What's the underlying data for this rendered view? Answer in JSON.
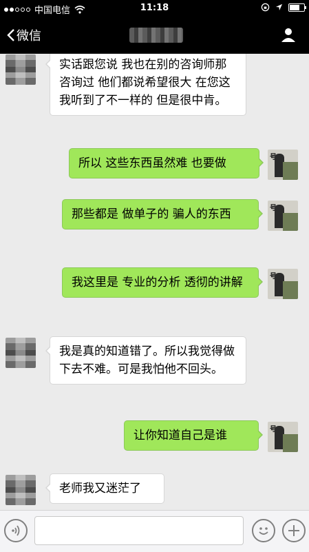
{
  "status_bar": {
    "carrier": "中国电信",
    "time": "11:18"
  },
  "nav": {
    "back_label": "微信"
  },
  "messages": [
    {
      "from": "peer",
      "text": "实话跟您说 我也在别的咨询师那咨询过 他们都说希望很大  在您这 我听到了不一样的 但是很中肯。"
    },
    {
      "from": "me",
      "text": "所以 这些东西虽然难 也要做"
    },
    {
      "from": "me",
      "text": "那些都是 做单子的   骗人的东西"
    },
    {
      "from": "me",
      "text": "我这里是 专业的分析 透彻的讲解"
    },
    {
      "from": "peer",
      "text": "我是真的知道错了。所以我觉得做下去不难。可是我怕他不回头。"
    },
    {
      "from": "me",
      "text": "让你知道自己是谁"
    },
    {
      "from": "peer",
      "text": "老师我又迷茫了"
    }
  ],
  "colors": {
    "outgoing_bubble": "#a0e75a",
    "incoming_bubble": "#ffffff",
    "background": "#ebebeb"
  },
  "icons": [
    "wifi-icon",
    "lock-rotation-icon",
    "location-icon",
    "battery-icon",
    "back-chevron-icon",
    "profile-icon",
    "voice-icon",
    "emoji-icon",
    "plus-icon"
  ]
}
